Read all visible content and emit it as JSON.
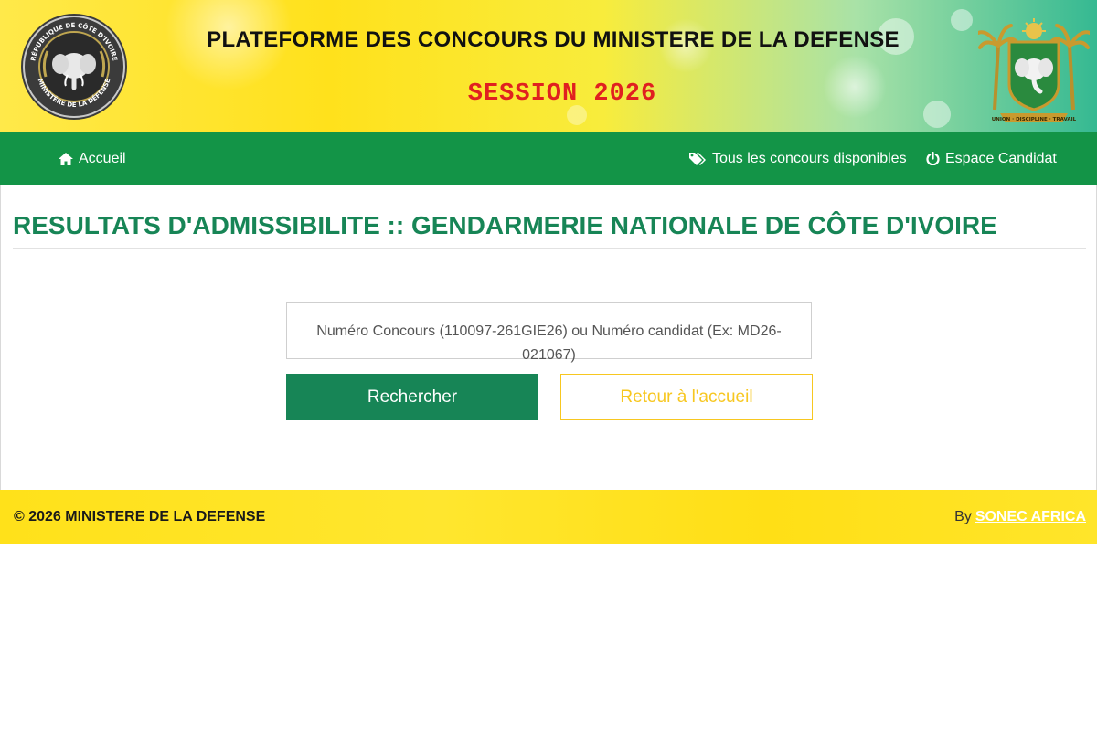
{
  "header": {
    "title": "PLATEFORME DES CONCOURS DU MINISTERE DE LA DEFENSE",
    "session": "SESSION 2026",
    "emblem_left_text_top": "RÉPUBLIQUE DE CÔTE D'IVOIRE",
    "emblem_left_text_bottom": "MINISTÈRE DE LA DÉFENSE",
    "emblem_right_motto": "UNION · DISCIPLINE · TRAVAIL"
  },
  "nav": {
    "home": {
      "label": "Accueil",
      "icon": "home-icon"
    },
    "concours": {
      "label": "Tous les concours disponibles",
      "icon": "tags-icon"
    },
    "candidat": {
      "label": "Espace Candidat",
      "icon": "power-icon"
    }
  },
  "page": {
    "title_strong": "RESULTATS D'ADMISSIBILITE",
    "title_rest": ":: GENDARMERIE NATIONALE DE CÔTE D'IVOIRE"
  },
  "search": {
    "placeholder": "Numéro Concours (110097-261GIE26) ou Numéro candidat (Ex: MD26-021067)",
    "submit_label": "Rechercher",
    "back_label": "Retour à l'accueil"
  },
  "footer": {
    "copyright": "© 2026 MINISTERE DE LA DEFENSE",
    "by_label": "By",
    "by_link": "SONEC AFRICA"
  },
  "colors": {
    "nav_green": "#139447",
    "title_green": "#178556",
    "button_green": "#178556",
    "accent_yellow": "#f7c720",
    "session_red": "#e02020",
    "footer_yellow": "#ffe11a"
  }
}
